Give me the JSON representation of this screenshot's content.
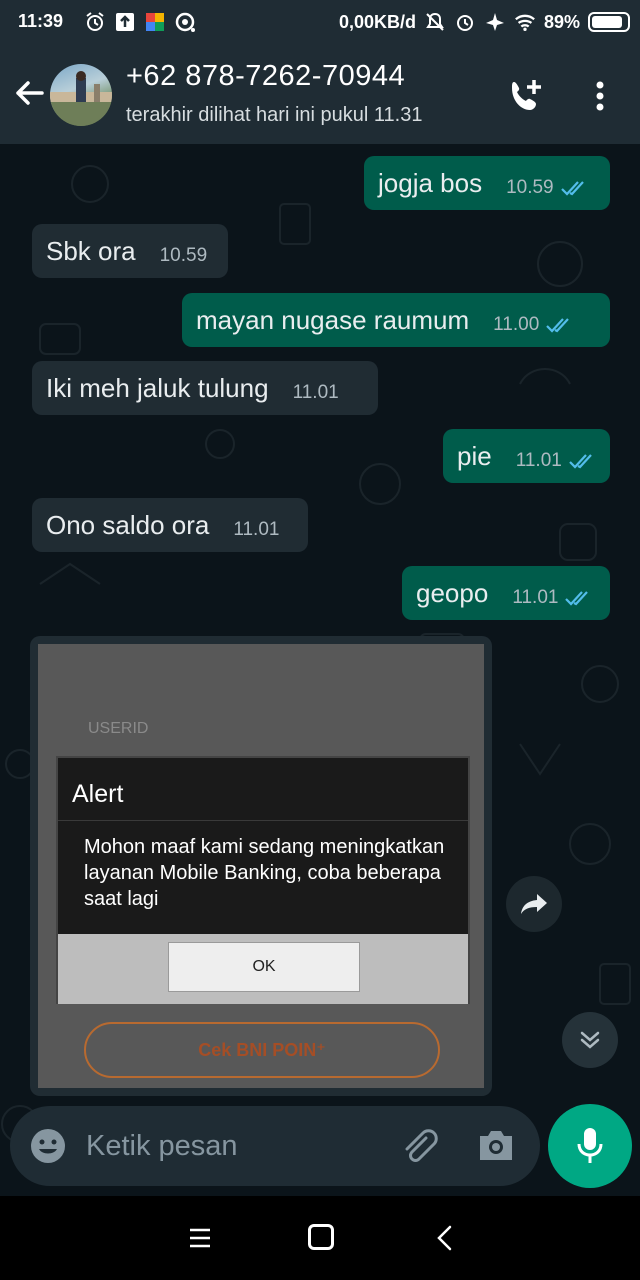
{
  "status_bar": {
    "time": "11:39",
    "network_speed": "0,00KB/d",
    "battery": "89%",
    "battery_level": 0.89,
    "icons": [
      "alarm-icon",
      "upload-icon",
      "app-icon",
      "signal-app-icon",
      "mute-icon",
      "alarm-icon",
      "airplane-icon",
      "wifi-icon",
      "battery-icon"
    ]
  },
  "header": {
    "name": "+62 878-7262-70944",
    "status": "terakhir dilihat hari ini pukul 11.31"
  },
  "messages": [
    {
      "dir": "out",
      "text": "jogja bos",
      "time": "10.59"
    },
    {
      "dir": "in",
      "text": "Sbk ora",
      "time": "10.59"
    },
    {
      "dir": "out",
      "text": "mayan nugase raumum",
      "time": "11.00"
    },
    {
      "dir": "in",
      "text": "Iki meh jaluk tulung",
      "time": "11.01"
    },
    {
      "dir": "out",
      "text": "pie",
      "time": "11.01"
    },
    {
      "dir": "in",
      "text": "Ono saldo ora",
      "time": "11.01"
    },
    {
      "dir": "out",
      "text": "geopo",
      "time": "11.01"
    }
  ],
  "image_message": {
    "userid_label": "USERID",
    "alert_title": "Alert",
    "alert_message": "Mohon maaf kami sedang meningkatkan layanan Mobile Banking, coba beberapa saat lagi",
    "ok_label": "OK",
    "bni_button": "Cek BNI POIN⁺"
  },
  "input": {
    "placeholder": "Ketik pesan"
  },
  "colors": {
    "outgoing": "#005c4b",
    "incoming": "#202c33",
    "accent": "#00a884",
    "read_ticks": "#53bdeb"
  }
}
